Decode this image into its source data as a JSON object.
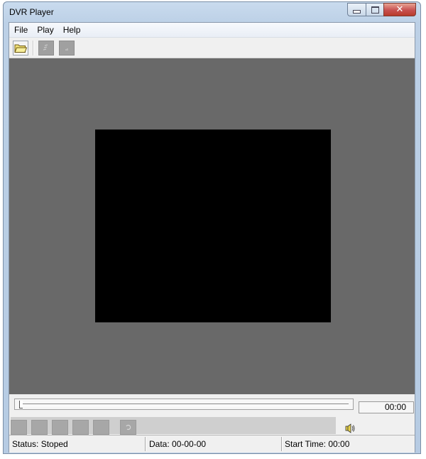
{
  "window": {
    "title": "DVR Player"
  },
  "caption_buttons": {
    "minimize_icon": "minimize-icon",
    "maximize_icon": "maximize-icon",
    "close_icon": "close-icon",
    "close_glyph": "✕"
  },
  "menu": {
    "items": [
      "File",
      "Play",
      "Help"
    ]
  },
  "toolbar": {
    "open_icon": "folder-open-icon",
    "disabled_buttons": [
      "snapshot-icon",
      "export-icon"
    ]
  },
  "playback": {
    "time_display": "00:00",
    "seek_position": 0
  },
  "controls": {
    "button_icons": [
      "play-icon",
      "pause-icon",
      "stop-icon",
      "slow-icon",
      "fast-icon",
      "refresh-icon"
    ],
    "volume_icon": "speaker-icon"
  },
  "status": {
    "status_text": "Status: Stoped",
    "data_text": "Data: 00-00-00",
    "start_time_text": "Start Time: 00:00"
  },
  "colors": {
    "video_bg": "#696969",
    "video_screen": "#000000",
    "close_red": "#c75050"
  }
}
